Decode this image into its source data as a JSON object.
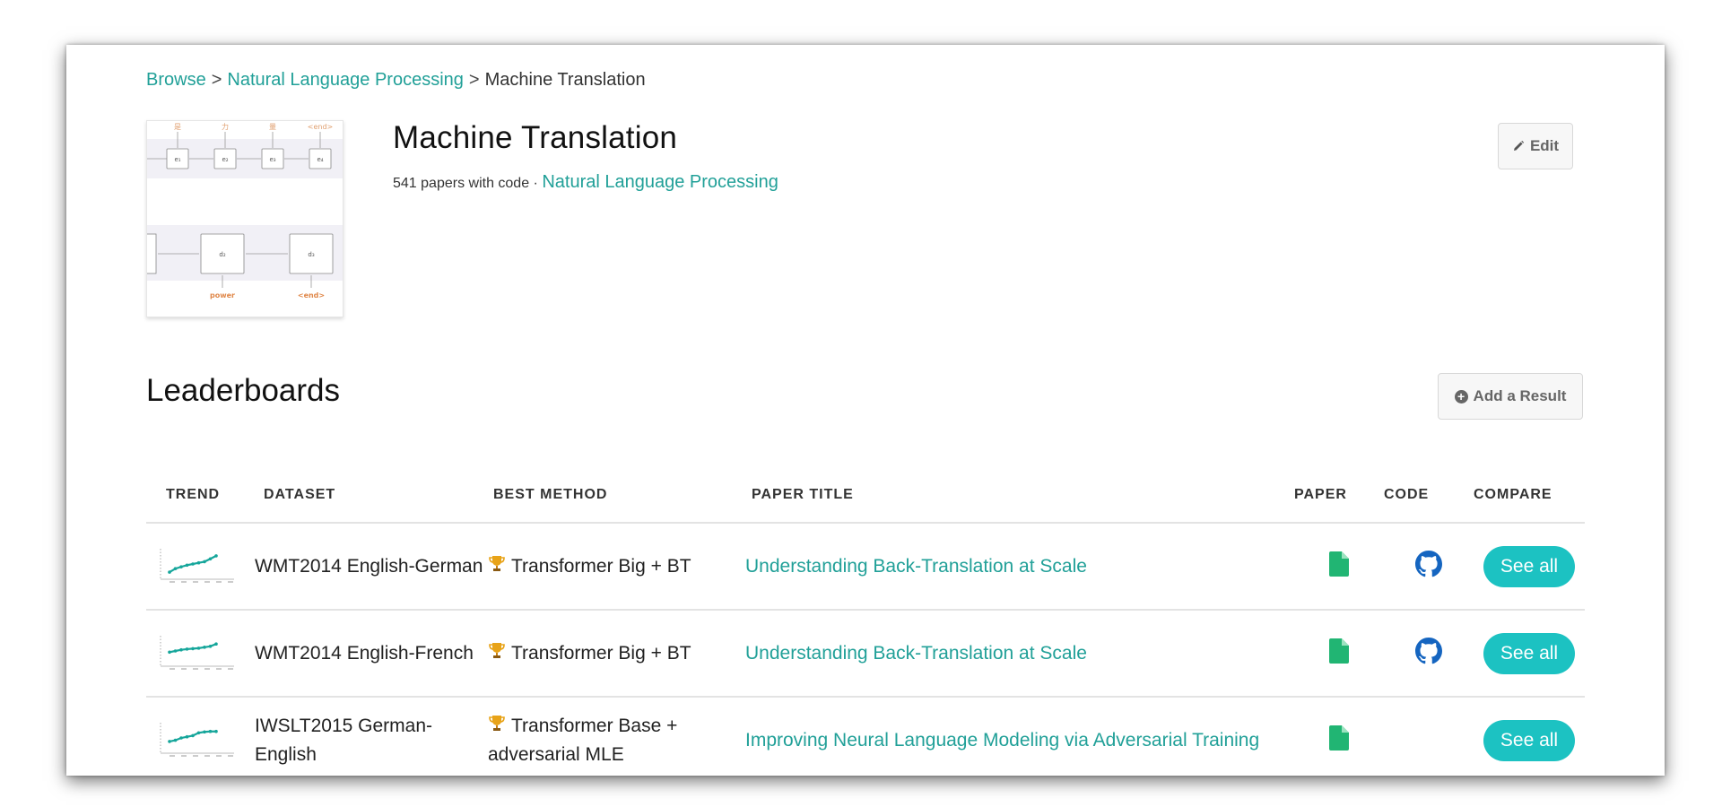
{
  "breadcrumb": {
    "browse": "Browse",
    "separator": ">",
    "category": "Natural Language Processing",
    "current": "Machine Translation"
  },
  "task": {
    "title": "Machine Translation",
    "papers_with_code": "541 papers with code ·",
    "area_link": "Natural Language Processing",
    "edit_label": "Edit"
  },
  "thumbnail": {
    "top_tokens": [
      "是",
      "力",
      "量",
      "<end>"
    ],
    "top_nodes": [
      "e₁",
      "e₂",
      "e₃",
      "e₄"
    ],
    "bottom_nodes": [
      "d₂",
      "d₃"
    ],
    "bottom_labels": [
      "power",
      "<end>"
    ]
  },
  "leaderboards": {
    "title": "Leaderboards",
    "add_result_label": "Add a Result",
    "columns": [
      "TREND",
      "DATASET",
      "BEST METHOD",
      "PAPER TITLE",
      "PAPER",
      "CODE",
      "COMPARE"
    ],
    "rows": [
      {
        "dataset": "WMT2014 English-German",
        "method": "Transformer Big + BT",
        "paper_title": "Understanding Back-Translation at Scale",
        "has_paper": true,
        "has_code": true,
        "compare_label": "See all",
        "trend": [
          0.15,
          0.3,
          0.38,
          0.45,
          0.5,
          0.55,
          0.6,
          0.72,
          0.85
        ]
      },
      {
        "dataset": "WMT2014 English-French",
        "method": "Transformer Big + BT",
        "paper_title": "Understanding Back-Translation at Scale",
        "has_paper": true,
        "has_code": true,
        "compare_label": "See all",
        "trend": [
          0.45,
          0.5,
          0.55,
          0.58,
          0.6,
          0.62,
          0.66,
          0.7,
          0.8
        ]
      },
      {
        "dataset": "IWSLT2015 German-English",
        "method": "Transformer Base + adversarial MLE",
        "paper_title": "Improving Neural Language Modeling via Adversarial Training",
        "has_paper": true,
        "has_code": false,
        "compare_label": "See all",
        "trend": [
          0.35,
          0.4,
          0.5,
          0.55,
          0.6,
          0.72,
          0.76,
          0.78,
          0.78
        ]
      }
    ]
  },
  "icons": {
    "paper": "file-icon",
    "code": "github-icon",
    "method": "trophy-icon"
  },
  "colors": {
    "accent": "#21a098",
    "see_all_bg": "#1cc2c2",
    "paper_icon": "#21b573",
    "github_icon": "#1565c0",
    "trend_line": "#16a69b"
  }
}
